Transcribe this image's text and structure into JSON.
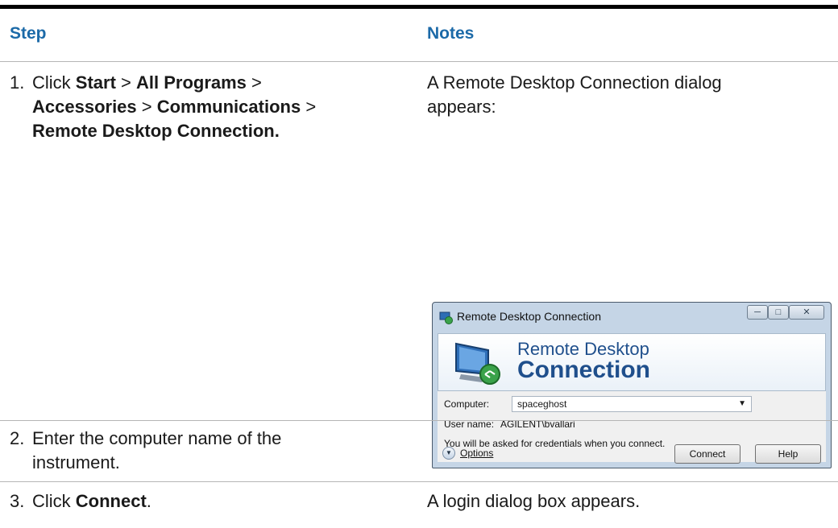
{
  "table": {
    "header_step": "Step",
    "header_notes": "Notes",
    "rows": [
      {
        "num": "1.",
        "step_parts": [
          "Click ",
          "Start",
          " > ",
          "All Programs",
          " >",
          "Accessories",
          " > ",
          "Communications",
          " >",
          "Remote Desktop Connection."
        ],
        "note": "A Remote Desktop Connection dialog appears:"
      },
      {
        "num": "2.",
        "step_line1": "Enter the computer name of the",
        "step_line2": "instrument.",
        "note": ""
      },
      {
        "num": "3.",
        "step_prefix": "Click ",
        "step_bold": "Connect",
        "step_suffix": ".",
        "note": "A login dialog box appears."
      }
    ]
  },
  "note1_line1": "A Remote Desktop Connection dialog",
  "note1_line2": "appears:",
  "dialog": {
    "title": "Remote Desktop Connection",
    "banner_line1": "Remote Desktop",
    "banner_line2": "Connection",
    "computer_label": "Computer:",
    "computer_value": "spaceghost",
    "username_label": "User name:",
    "username_value": "AGILENT\\bvallari",
    "credentials_msg": "You will be asked for credentials when you connect.",
    "options_label": "Options",
    "connect_label": "Connect",
    "help_label": "Help"
  }
}
